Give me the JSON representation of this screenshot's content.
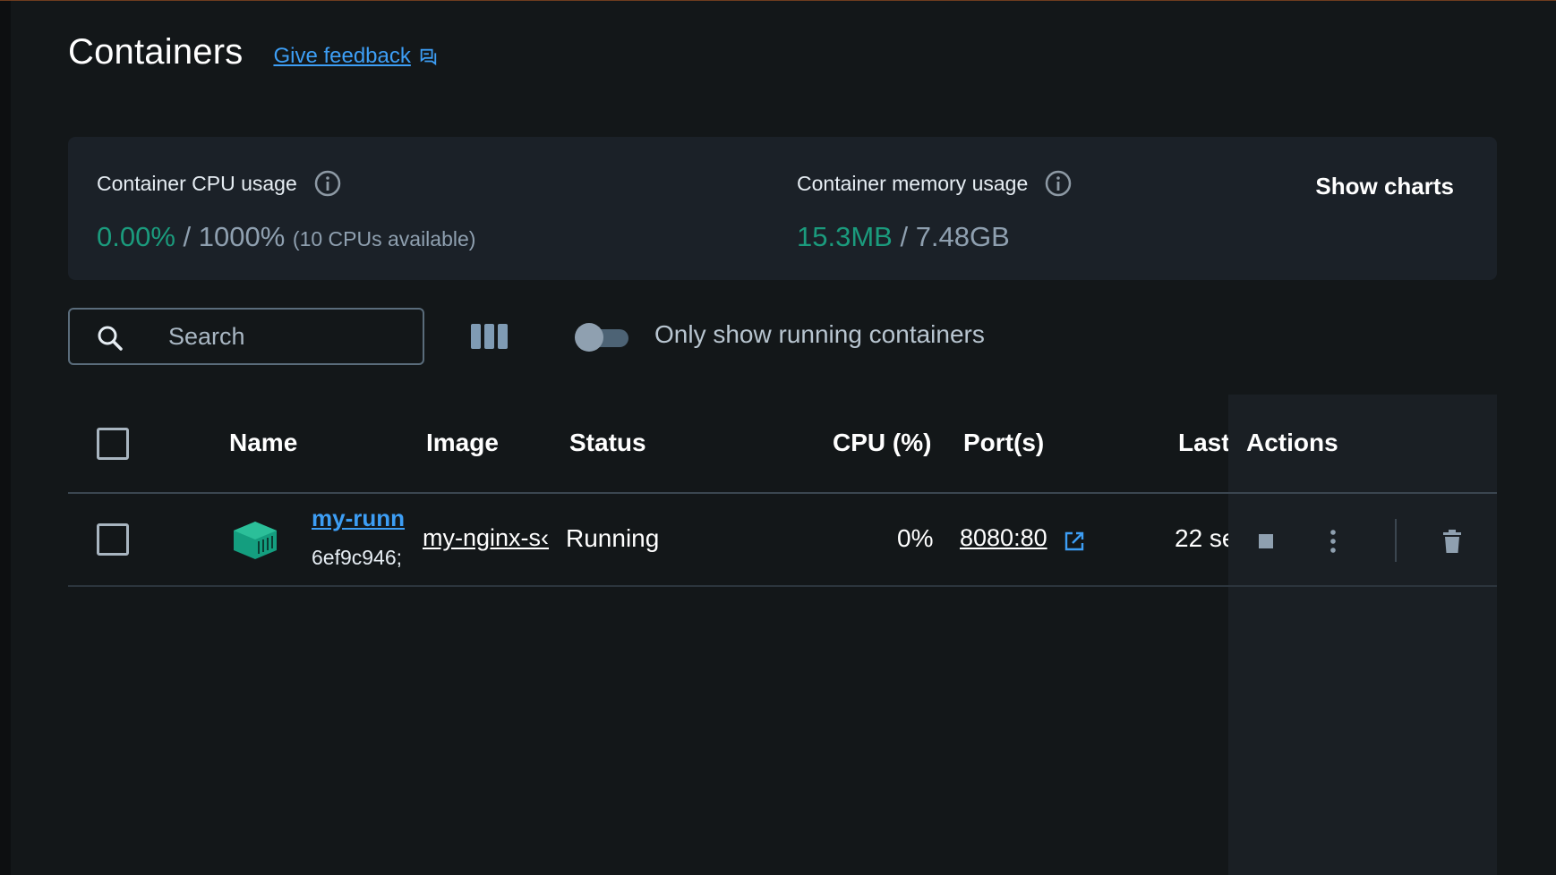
{
  "header": {
    "title": "Containers",
    "feedback_label": "Give feedback"
  },
  "stats": {
    "cpu": {
      "label": "Container CPU usage",
      "used": "0.00%",
      "separator": " / ",
      "total": "1000%",
      "note": "(10 CPUs available)"
    },
    "memory": {
      "label": "Container memory usage",
      "used": "15.3MB",
      "separator": " / ",
      "total": "7.48GB"
    },
    "show_charts_label": "Show charts"
  },
  "toolbar": {
    "search_placeholder": "Search",
    "toggle_label": "Only show running containers",
    "toggle_on": false
  },
  "table": {
    "columns": {
      "name": "Name",
      "image": "Image",
      "status": "Status",
      "cpu": "CPU (%)",
      "ports": "Port(s)",
      "last_started": "Last",
      "actions": "Actions"
    },
    "rows": [
      {
        "name": "my-runn",
        "id": "6ef9c946;",
        "image": "my-nginx-s‹",
        "status": "Running",
        "cpu": "0%",
        "ports": "8080:80",
        "last_started": "22 se"
      }
    ]
  },
  "colors": {
    "background": "#131719",
    "card": "#1b2128",
    "accent_green": "#1b9b7d",
    "link_blue": "#3d9ef5",
    "muted": "#8fa0b0"
  },
  "icons": {
    "feedback": "feedback-icon",
    "info": "info-icon",
    "search": "search-icon",
    "columns": "columns-icon",
    "container": "container-icon",
    "external_link": "external-link-icon",
    "stop": "stop-icon",
    "more": "more-vertical-icon",
    "delete": "trash-icon"
  }
}
